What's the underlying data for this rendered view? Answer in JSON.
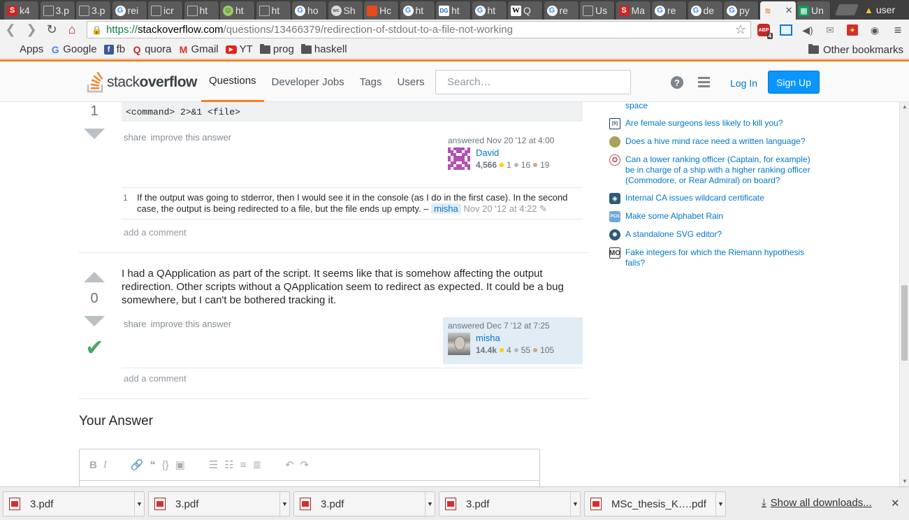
{
  "browser": {
    "tabs": [
      {
        "label": "k4",
        "icon": "S",
        "color": "#c62828"
      },
      {
        "label": "3.p",
        "icon": "doc",
        "color": "#777"
      },
      {
        "label": "3.p",
        "icon": "doc",
        "color": "#777"
      },
      {
        "label": "rei",
        "icon": "G",
        "color": "#4285f4"
      },
      {
        "label": "icr",
        "icon": "doc",
        "color": "#777"
      },
      {
        "label": "ht",
        "icon": "doc",
        "color": "#777"
      },
      {
        "label": "ht",
        "icon": "smiley",
        "color": "#9ccc65"
      },
      {
        "label": "ht",
        "icon": "doc",
        "color": "#777"
      },
      {
        "label": "ho",
        "icon": "G",
        "color": "#4285f4"
      },
      {
        "label": "Sh",
        "icon": "wc",
        "color": "#999"
      },
      {
        "label": "Hc",
        "icon": "bookmark",
        "color": "#e64a19"
      },
      {
        "label": "ht",
        "icon": "G",
        "color": "#4285f4"
      },
      {
        "label": "ht",
        "icon": "DG",
        "color": "#1565c0"
      },
      {
        "label": "ht",
        "icon": "G",
        "color": "#4285f4"
      },
      {
        "label": "Q",
        "icon": "W",
        "color": "#222"
      },
      {
        "label": "re",
        "icon": "G",
        "color": "#4285f4"
      },
      {
        "label": "Us",
        "icon": "doc",
        "color": "#777"
      },
      {
        "label": "Ma",
        "icon": "S",
        "color": "#c62828"
      },
      {
        "label": "re",
        "icon": "G",
        "color": "#4285f4"
      },
      {
        "label": "de",
        "icon": "G",
        "color": "#4285f4"
      },
      {
        "label": "py",
        "icon": "G",
        "color": "#4285f4"
      },
      {
        "label": "",
        "icon": "so",
        "color": "#f48024",
        "active": true
      },
      {
        "label": "Un",
        "icon": "sheet",
        "color": "#0f9d58"
      }
    ],
    "profile_label": "user",
    "url": {
      "scheme": "https://",
      "host": "stackoverflow.com",
      "path": "/questions/13466379/redirection-of-stdout-to-a-file-not-working"
    },
    "abp_badge": "4",
    "bookmarks": [
      {
        "label": "Apps",
        "icon": "apps-icon"
      },
      {
        "label": "Google",
        "icon": "google-icon"
      },
      {
        "label": "fb",
        "icon": "facebook-icon"
      },
      {
        "label": "quora",
        "icon": "quora-icon"
      },
      {
        "label": "Gmail",
        "icon": "gmail-icon"
      },
      {
        "label": "YT",
        "icon": "youtube-icon"
      },
      {
        "label": "prog",
        "icon": "folder-icon"
      },
      {
        "label": "haskell",
        "icon": "folder-icon"
      }
    ],
    "other_bookmarks": "Other bookmarks"
  },
  "so_header": {
    "logo_light": "stack",
    "logo_bold": "overflow",
    "nav": [
      "Questions",
      "Developer Jobs",
      "Tags",
      "Users"
    ],
    "search_placeholder": "Search…",
    "login": "Log In",
    "signup": "Sign Up"
  },
  "answer1": {
    "score": "1",
    "code": "<command> 2>&1 <file>",
    "menu": [
      "share",
      "improve this answer"
    ],
    "answered": "answered Nov 20 '12 at 4:00",
    "user": "David",
    "rep": "4,566",
    "gold": "1",
    "silver": "16",
    "bronze": "19",
    "comment": {
      "score": "1",
      "text": "If the output was going to stderror, then I would see it in the console (as I do in the first case). In the second case, the output is being redirected to a file, but the file ends up empty. –",
      "user": "misha",
      "date": "Nov 20 '12 at 4:22"
    },
    "add_comment": "add a comment"
  },
  "answer2": {
    "score": "0",
    "text": "I had a QApplication as part of the script. It seems like that is somehow affecting the output redirection. Other scripts without a QApplication seem to redirect as expected. It could be a bug somewhere, but I can't be bothered tracking it.",
    "menu": [
      "share",
      "improve this answer"
    ],
    "answered": "answered Dec 7 '12 at 7:25",
    "user": "misha",
    "rep": "14.4k",
    "gold": "4",
    "silver": "55",
    "bronze": "105",
    "add_comment": "add a comment"
  },
  "your_answer": "Your Answer",
  "sidebar": {
    "partial_text": "space",
    "hot_questions": [
      {
        "text": "Are female surgeons less likely to kill you?",
        "icon": "S"
      },
      {
        "text": "Does a hive mind race need a written language?",
        "icon": "wb"
      },
      {
        "text": "Can a lower ranking officer (Captain, for example) be in charge of a ship with a higher ranking officer (Commodore, or Rear Admiral) on board?",
        "icon": "hsm"
      },
      {
        "text": "Internal CA issues wildcard certificate",
        "icon": "sec"
      },
      {
        "text": "Make some Alphabet Rain",
        "icon": "PCG"
      },
      {
        "text": "A standalone SVG editor?",
        "icon": "sr"
      },
      {
        "text": "Fake integers for which the Riemann hypothesis fails?",
        "icon": "MO"
      }
    ]
  },
  "downloads": {
    "items": [
      "3.pdf",
      "3.pdf",
      "3.pdf",
      "3.pdf",
      "MSc_thesis_K….pdf"
    ],
    "show_all": "Show all downloads..."
  }
}
